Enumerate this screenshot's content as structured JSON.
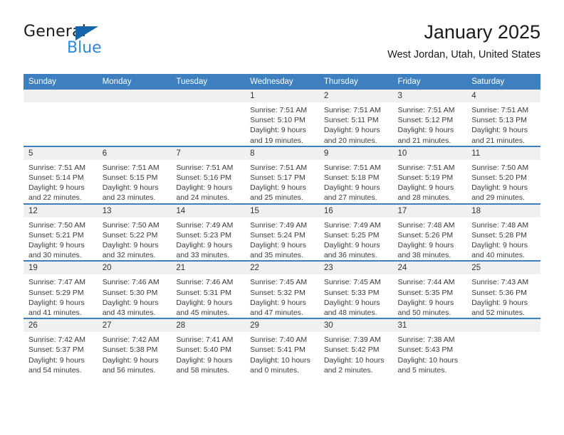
{
  "brand": {
    "name_part1": "General",
    "name_part2": "Blue",
    "accent_color": "#2f89d4",
    "triangle_color": "#1565a8"
  },
  "header": {
    "title": "January 2025",
    "subtitle": "West Jordan, Utah, United States"
  },
  "calendar": {
    "header_color": "#3d7fbf",
    "weekday_headers": [
      "Sunday",
      "Monday",
      "Tuesday",
      "Wednesday",
      "Thursday",
      "Friday",
      "Saturday"
    ],
    "weeks": [
      [
        {
          "day": "",
          "sunrise": "",
          "sunset": "",
          "daylight_line1": "",
          "daylight_line2": ""
        },
        {
          "day": "",
          "sunrise": "",
          "sunset": "",
          "daylight_line1": "",
          "daylight_line2": ""
        },
        {
          "day": "",
          "sunrise": "",
          "sunset": "",
          "daylight_line1": "",
          "daylight_line2": ""
        },
        {
          "day": "1",
          "sunrise": "Sunrise: 7:51 AM",
          "sunset": "Sunset: 5:10 PM",
          "daylight_line1": "Daylight: 9 hours",
          "daylight_line2": "and 19 minutes."
        },
        {
          "day": "2",
          "sunrise": "Sunrise: 7:51 AM",
          "sunset": "Sunset: 5:11 PM",
          "daylight_line1": "Daylight: 9 hours",
          "daylight_line2": "and 20 minutes."
        },
        {
          "day": "3",
          "sunrise": "Sunrise: 7:51 AM",
          "sunset": "Sunset: 5:12 PM",
          "daylight_line1": "Daylight: 9 hours",
          "daylight_line2": "and 21 minutes."
        },
        {
          "day": "4",
          "sunrise": "Sunrise: 7:51 AM",
          "sunset": "Sunset: 5:13 PM",
          "daylight_line1": "Daylight: 9 hours",
          "daylight_line2": "and 21 minutes."
        }
      ],
      [
        {
          "day": "5",
          "sunrise": "Sunrise: 7:51 AM",
          "sunset": "Sunset: 5:14 PM",
          "daylight_line1": "Daylight: 9 hours",
          "daylight_line2": "and 22 minutes."
        },
        {
          "day": "6",
          "sunrise": "Sunrise: 7:51 AM",
          "sunset": "Sunset: 5:15 PM",
          "daylight_line1": "Daylight: 9 hours",
          "daylight_line2": "and 23 minutes."
        },
        {
          "day": "7",
          "sunrise": "Sunrise: 7:51 AM",
          "sunset": "Sunset: 5:16 PM",
          "daylight_line1": "Daylight: 9 hours",
          "daylight_line2": "and 24 minutes."
        },
        {
          "day": "8",
          "sunrise": "Sunrise: 7:51 AM",
          "sunset": "Sunset: 5:17 PM",
          "daylight_line1": "Daylight: 9 hours",
          "daylight_line2": "and 25 minutes."
        },
        {
          "day": "9",
          "sunrise": "Sunrise: 7:51 AM",
          "sunset": "Sunset: 5:18 PM",
          "daylight_line1": "Daylight: 9 hours",
          "daylight_line2": "and 27 minutes."
        },
        {
          "day": "10",
          "sunrise": "Sunrise: 7:51 AM",
          "sunset": "Sunset: 5:19 PM",
          "daylight_line1": "Daylight: 9 hours",
          "daylight_line2": "and 28 minutes."
        },
        {
          "day": "11",
          "sunrise": "Sunrise: 7:50 AM",
          "sunset": "Sunset: 5:20 PM",
          "daylight_line1": "Daylight: 9 hours",
          "daylight_line2": "and 29 minutes."
        }
      ],
      [
        {
          "day": "12",
          "sunrise": "Sunrise: 7:50 AM",
          "sunset": "Sunset: 5:21 PM",
          "daylight_line1": "Daylight: 9 hours",
          "daylight_line2": "and 30 minutes."
        },
        {
          "day": "13",
          "sunrise": "Sunrise: 7:50 AM",
          "sunset": "Sunset: 5:22 PM",
          "daylight_line1": "Daylight: 9 hours",
          "daylight_line2": "and 32 minutes."
        },
        {
          "day": "14",
          "sunrise": "Sunrise: 7:49 AM",
          "sunset": "Sunset: 5:23 PM",
          "daylight_line1": "Daylight: 9 hours",
          "daylight_line2": "and 33 minutes."
        },
        {
          "day": "15",
          "sunrise": "Sunrise: 7:49 AM",
          "sunset": "Sunset: 5:24 PM",
          "daylight_line1": "Daylight: 9 hours",
          "daylight_line2": "and 35 minutes."
        },
        {
          "day": "16",
          "sunrise": "Sunrise: 7:49 AM",
          "sunset": "Sunset: 5:25 PM",
          "daylight_line1": "Daylight: 9 hours",
          "daylight_line2": "and 36 minutes."
        },
        {
          "day": "17",
          "sunrise": "Sunrise: 7:48 AM",
          "sunset": "Sunset: 5:26 PM",
          "daylight_line1": "Daylight: 9 hours",
          "daylight_line2": "and 38 minutes."
        },
        {
          "day": "18",
          "sunrise": "Sunrise: 7:48 AM",
          "sunset": "Sunset: 5:28 PM",
          "daylight_line1": "Daylight: 9 hours",
          "daylight_line2": "and 40 minutes."
        }
      ],
      [
        {
          "day": "19",
          "sunrise": "Sunrise: 7:47 AM",
          "sunset": "Sunset: 5:29 PM",
          "daylight_line1": "Daylight: 9 hours",
          "daylight_line2": "and 41 minutes."
        },
        {
          "day": "20",
          "sunrise": "Sunrise: 7:46 AM",
          "sunset": "Sunset: 5:30 PM",
          "daylight_line1": "Daylight: 9 hours",
          "daylight_line2": "and 43 minutes."
        },
        {
          "day": "21",
          "sunrise": "Sunrise: 7:46 AM",
          "sunset": "Sunset: 5:31 PM",
          "daylight_line1": "Daylight: 9 hours",
          "daylight_line2": "and 45 minutes."
        },
        {
          "day": "22",
          "sunrise": "Sunrise: 7:45 AM",
          "sunset": "Sunset: 5:32 PM",
          "daylight_line1": "Daylight: 9 hours",
          "daylight_line2": "and 47 minutes."
        },
        {
          "day": "23",
          "sunrise": "Sunrise: 7:45 AM",
          "sunset": "Sunset: 5:33 PM",
          "daylight_line1": "Daylight: 9 hours",
          "daylight_line2": "and 48 minutes."
        },
        {
          "day": "24",
          "sunrise": "Sunrise: 7:44 AM",
          "sunset": "Sunset: 5:35 PM",
          "daylight_line1": "Daylight: 9 hours",
          "daylight_line2": "and 50 minutes."
        },
        {
          "day": "25",
          "sunrise": "Sunrise: 7:43 AM",
          "sunset": "Sunset: 5:36 PM",
          "daylight_line1": "Daylight: 9 hours",
          "daylight_line2": "and 52 minutes."
        }
      ],
      [
        {
          "day": "26",
          "sunrise": "Sunrise: 7:42 AM",
          "sunset": "Sunset: 5:37 PM",
          "daylight_line1": "Daylight: 9 hours",
          "daylight_line2": "and 54 minutes."
        },
        {
          "day": "27",
          "sunrise": "Sunrise: 7:42 AM",
          "sunset": "Sunset: 5:38 PM",
          "daylight_line1": "Daylight: 9 hours",
          "daylight_line2": "and 56 minutes."
        },
        {
          "day": "28",
          "sunrise": "Sunrise: 7:41 AM",
          "sunset": "Sunset: 5:40 PM",
          "daylight_line1": "Daylight: 9 hours",
          "daylight_line2": "and 58 minutes."
        },
        {
          "day": "29",
          "sunrise": "Sunrise: 7:40 AM",
          "sunset": "Sunset: 5:41 PM",
          "daylight_line1": "Daylight: 10 hours",
          "daylight_line2": "and 0 minutes."
        },
        {
          "day": "30",
          "sunrise": "Sunrise: 7:39 AM",
          "sunset": "Sunset: 5:42 PM",
          "daylight_line1": "Daylight: 10 hours",
          "daylight_line2": "and 2 minutes."
        },
        {
          "day": "31",
          "sunrise": "Sunrise: 7:38 AM",
          "sunset": "Sunset: 5:43 PM",
          "daylight_line1": "Daylight: 10 hours",
          "daylight_line2": "and 5 minutes."
        },
        {
          "day": "",
          "sunrise": "",
          "sunset": "",
          "daylight_line1": "",
          "daylight_line2": ""
        }
      ]
    ]
  }
}
